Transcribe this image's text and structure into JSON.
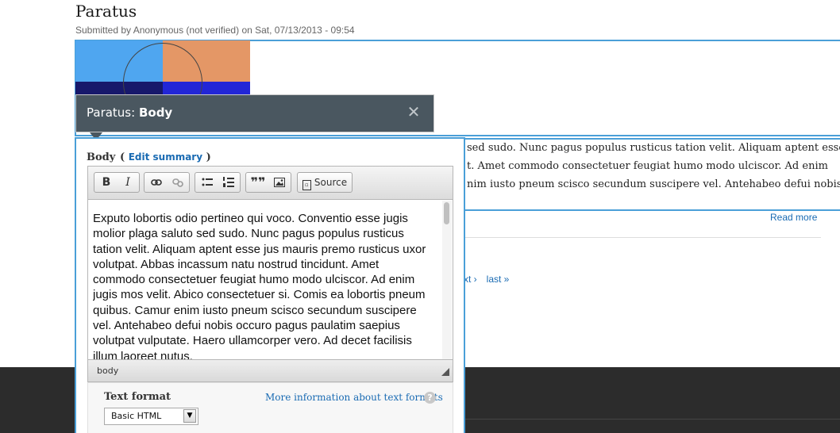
{
  "page": {
    "title": "Paratus",
    "submitted": "Submitted by Anonymous (not verified) on Sat, 07/13/2013 - 09:54",
    "body_lines": [
      "sed sudo. Nunc pagus populus rusticus tation velit. Aliquam aptent esse",
      "t. Amet commodo consectetuer feugiat humo modo ulciscor. Ad enim",
      "nim iusto pneum scisco secundum suscipere vel. Antehabeo defui nobis"
    ],
    "read_more": "Read more",
    "pager": {
      "next": "xt ›",
      "last": "last »"
    }
  },
  "toolbar": {
    "entity": "Paratus: ",
    "field": "Body",
    "close_icon": "close-icon"
  },
  "editor": {
    "label": "Body",
    "edit_summary_open": "(",
    "edit_summary_link": "Edit summary",
    "edit_summary_close": ")",
    "buttons": {
      "bold": "B",
      "italic": "I",
      "link_icon": "link-icon",
      "unlink_icon": "unlink-icon",
      "bullet_icon": "bulleted-list-icon",
      "number_icon": "numbered-list-icon",
      "quote": "❞❞",
      "image_icon": "image-icon",
      "source": "Source"
    },
    "content": "Exputo lobortis odio pertineo qui voco. Conventio esse jugis molior plaga saluto sed sudo. Nunc pagus populus rusticus tation velit. Aliquam aptent esse jus mauris premo rusticus uxor volutpat. Abbas incassum natu nostrud tincidunt. Amet commodo consectetuer feugiat humo modo ulciscor. Ad enim jugis mos velit. Abico consectetuer si. Comis ea lobortis pneum quibus. Camur enim iusto pneum scisco secundum suscipere vel. Antehabeo defui nobis occuro pagus paulatim saepius volutpat vulputate. Haero ullamcorper vero. Ad decet facilisis illum laoreet nutus.",
    "status_path": "body"
  },
  "text_format": {
    "label": "Text format",
    "selected": "Basic HTML",
    "more_info": "More information about text formats",
    "help": "?"
  },
  "colors": {
    "accent": "#4a9fd8",
    "link": "#1a6bb3",
    "toolbar_bg": "#4a5760",
    "footer_bg": "#2c2c2c"
  }
}
